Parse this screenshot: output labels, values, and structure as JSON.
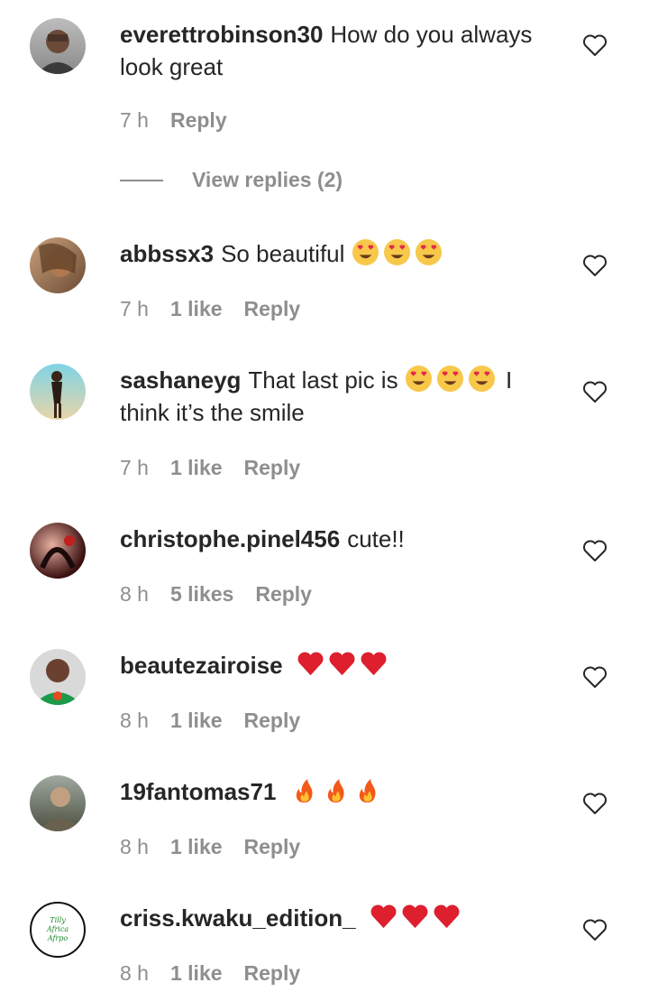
{
  "comments": [
    {
      "username": "everettrobinson30",
      "text": "How do you always look great",
      "time": "7 h",
      "likes": "",
      "reply": "Reply",
      "emoji": ""
    },
    {
      "username": "abbssx3",
      "text": "So beautiful",
      "time": "7 h",
      "likes": "1 like",
      "reply": "Reply",
      "emoji": "heart-eyes"
    },
    {
      "username": "sashaneyg",
      "text_before": "That last pic is",
      "text_after": "I think it’s the smile",
      "time": "7 h",
      "likes": "1 like",
      "reply": "Reply",
      "emoji": "heart-eyes"
    },
    {
      "username": "christophe.pinel456",
      "text": "cute!!",
      "time": "8 h",
      "likes": "5 likes",
      "reply": "Reply",
      "emoji": ""
    },
    {
      "username": "beautezairoise",
      "text": "",
      "time": "8 h",
      "likes": "1 like",
      "reply": "Reply",
      "emoji": "red-heart"
    },
    {
      "username": "19fantomas71",
      "text": "",
      "time": "8 h",
      "likes": "1 like",
      "reply": "Reply",
      "emoji": "fire"
    },
    {
      "username": "criss.kwaku_edition_",
      "text": "",
      "time": "8 h",
      "likes": "1 like",
      "reply": "Reply",
      "emoji": "red-heart"
    }
  ],
  "view_replies": "View replies (2)",
  "avatar_text": {
    "line1": "Tilly",
    "line2": "Africa",
    "line3": "Afrpo"
  },
  "colors": {
    "text": "#262626",
    "meta": "#8e8e8e"
  }
}
